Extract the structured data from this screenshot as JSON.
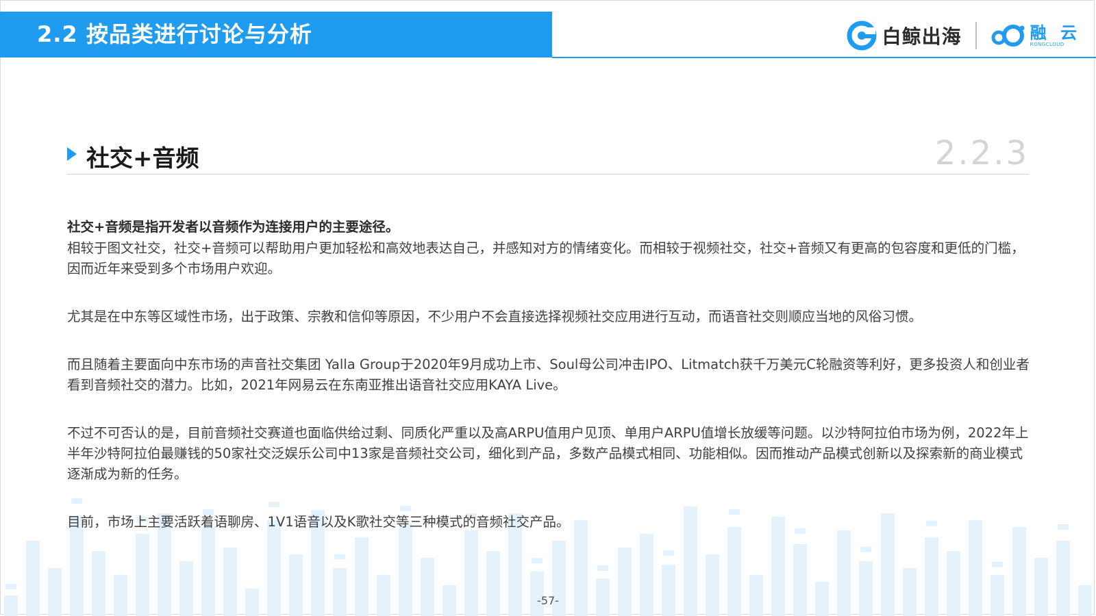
{
  "header": {
    "title": "2.2 按品类进行讨论与分析",
    "brand1": "白鲸出海",
    "brand2": "融 云",
    "brand2_sub": "RONGCLOUD"
  },
  "section": {
    "title": "社交+音频",
    "number": "2.2.3"
  },
  "paragraphs": {
    "lead": "社交+音频是指开发者以音频作为连接用户的主要途径。",
    "p1": "相较于图文社交，社交+音频可以帮助用户更加轻松和高效地表达自己，并感知对方的情绪变化。而相较于视频社交，社交+音频又有更高的包容度和更低的门槛，因而近年来受到多个市场用户欢迎。",
    "p2": "尤其是在中东等区域性市场，出于政策、宗教和信仰等原因，不少用户不会直接选择视频社交应用进行互动，而语音社交则顺应当地的风俗习惯。",
    "p3": "而且随着主要面向中东市场的声音社交集团 Yalla Group于2020年9月成功上市、Soul母公司冲击IPO、Litmatch获千万美元C轮融资等利好，更多投资人和创业者看到音频社交的潜力。比如，2021年网易云在东南亚推出语音社交应用KAYA Live。",
    "p4": "不过不可否认的是，目前音频社交赛道也面临供给过剩、同质化严重以及高ARPU值用户见顶、单用户ARPU值增长放缓等问题。以沙特阿拉伯市场为例，2022年上半年沙特阿拉伯最赚钱的50家社交泛娱乐公司中13家是音频社交公司，细化到产品，多数产品模式相同、功能相似。因而推动产品模式创新以及探索新的商业模式逐渐成为新的任务。",
    "p5": "目前，市场上主要活跃着语聊房、1V1语音以及K歌社交等三种模式的音频社交产品。"
  },
  "footer": {
    "page": "-57-"
  },
  "colors": {
    "accent": "#1f9cf0",
    "bars": "#e3f2fd"
  }
}
